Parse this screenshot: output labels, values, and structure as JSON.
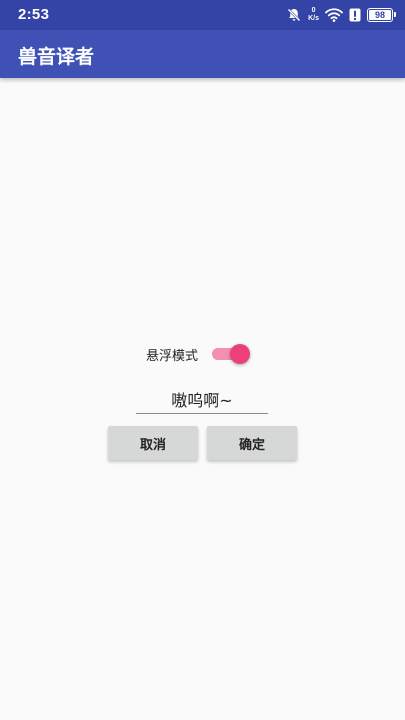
{
  "status_bar": {
    "time": "2:53",
    "netspeed_value": "0",
    "netspeed_unit": "K/s",
    "battery_level": "98",
    "battery_fraction": 0.98,
    "icons": [
      "bell-off-icon",
      "netspeed-indicator",
      "wifi-icon",
      "alert-icon",
      "battery-icon"
    ]
  },
  "app_bar": {
    "title": "兽音译者"
  },
  "main": {
    "float_mode_label": "悬浮模式",
    "float_mode_on": true,
    "input_value": "嗷呜啊~",
    "cancel_label": "取消",
    "ok_label": "确定"
  },
  "colors": {
    "status_bar": "#3443a6",
    "app_bar": "#3f51b5",
    "switch_thumb": "#ec407a",
    "switch_track": "#f48fb1",
    "button": "#d6d7d7",
    "background": "#fafafa"
  }
}
